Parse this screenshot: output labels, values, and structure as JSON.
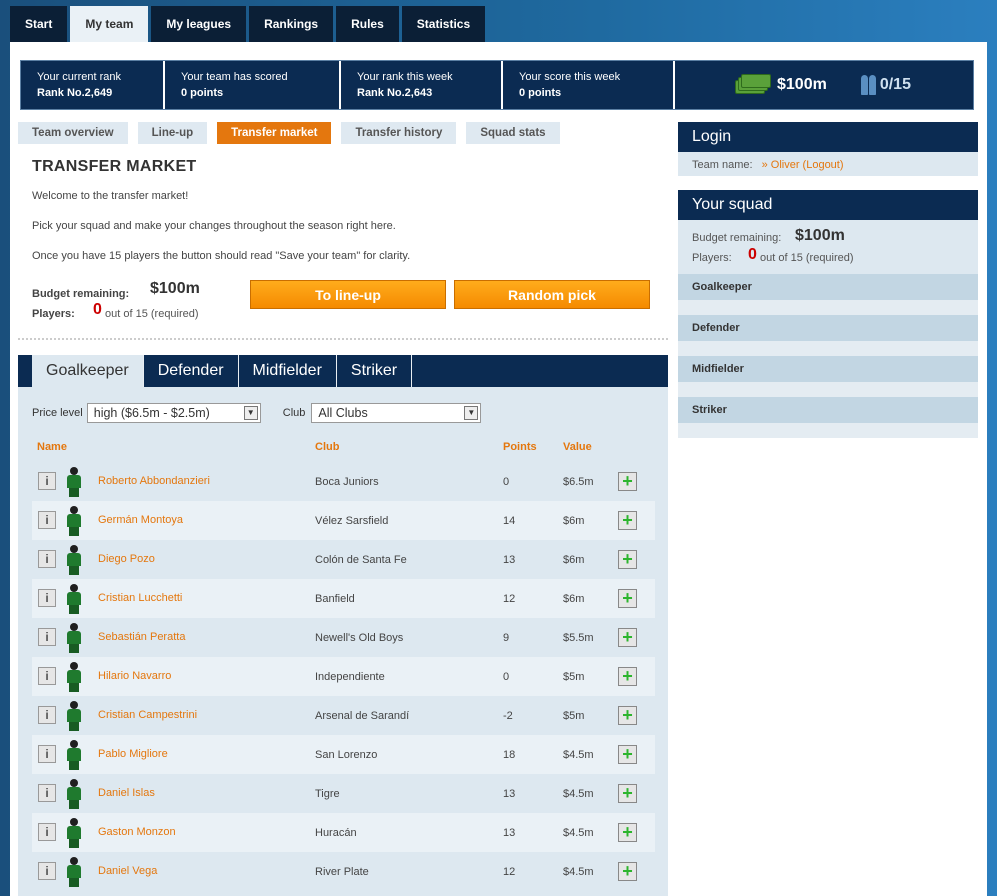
{
  "nav": {
    "tabs": [
      {
        "label": "Start"
      },
      {
        "label": "My team"
      },
      {
        "label": "My leagues"
      },
      {
        "label": "Rankings"
      },
      {
        "label": "Rules"
      },
      {
        "label": "Statistics"
      }
    ],
    "active": "My team"
  },
  "stats": {
    "current_rank_label": "Your current rank",
    "current_rank_value": "Rank No.2,649",
    "scored_label": "Your team has scored",
    "scored_value": "0 points",
    "week_rank_label": "Your rank this week",
    "week_rank_value": "Rank No.2,643",
    "week_score_label": "Your score this week",
    "week_score_value": "0 points",
    "money": "$100m",
    "players_count": "0/15"
  },
  "subtabs": [
    "Team overview",
    "Line-up",
    "Transfer market",
    "Transfer history",
    "Squad stats"
  ],
  "main": {
    "title": "TRANSFER MARKET",
    "intro1": "Welcome to the transfer market!",
    "intro2": "Pick your squad and make your changes throughout the season right here.",
    "intro3": "Once you have 15 players the button should read \"Save your team\" for clarity.",
    "budget_label": "Budget remaining:",
    "budget_value": "$100m",
    "players_label": "Players:",
    "players_count": "0",
    "players_required": "out of 15 (required)",
    "btn_lineup": "To line-up",
    "btn_random": "Random pick"
  },
  "positions": [
    "Goalkeeper",
    "Defender",
    "Midfielder",
    "Striker"
  ],
  "filters": {
    "price_label": "Price level",
    "price_value": "high ($6.5m - $2.5m)",
    "club_label": "Club",
    "club_value": "All Clubs"
  },
  "table": {
    "headers": {
      "name": "Name",
      "club": "Club",
      "points": "Points",
      "value": "Value"
    },
    "rows": [
      {
        "name": "Roberto Abbondanzieri",
        "club": "Boca Juniors",
        "points": "0",
        "value": "$6.5m"
      },
      {
        "name": "Germán Montoya",
        "club": "Vélez Sarsfield",
        "points": "14",
        "value": "$6m"
      },
      {
        "name": "Diego Pozo",
        "club": "Colón de Santa Fe",
        "points": "13",
        "value": "$6m"
      },
      {
        "name": "Cristian Lucchetti",
        "club": "Banfield",
        "points": "12",
        "value": "$6m"
      },
      {
        "name": "Sebastián Peratta",
        "club": "Newell's Old Boys",
        "points": "9",
        "value": "$5.5m"
      },
      {
        "name": "Hilario Navarro",
        "club": "Independiente",
        "points": "0",
        "value": "$5m"
      },
      {
        "name": "Cristian Campestrini",
        "club": "Arsenal de Sarandí",
        "points": "-2",
        "value": "$5m"
      },
      {
        "name": "Pablo Migliore",
        "club": "San Lorenzo",
        "points": "18",
        "value": "$4.5m"
      },
      {
        "name": "Daniel Islas",
        "club": "Tigre",
        "points": "13",
        "value": "$4.5m"
      },
      {
        "name": "Gaston Monzon",
        "club": "Huracán",
        "points": "13",
        "value": "$4.5m"
      },
      {
        "name": "Daniel Vega",
        "club": "River Plate",
        "points": "12",
        "value": "$4.5m"
      }
    ]
  },
  "sidebar": {
    "login_title": "Login",
    "team_name_label": "Team name:",
    "team_name_link": "» Oliver (Logout)",
    "squad_title": "Your squad",
    "budget_label": "Budget remaining:",
    "budget_value": "$100m",
    "players_label": "Players:",
    "players_count": "0",
    "players_required": "out of 15 (required)",
    "groups": [
      "Goalkeeper",
      "Defender",
      "Midfielder",
      "Striker"
    ]
  }
}
